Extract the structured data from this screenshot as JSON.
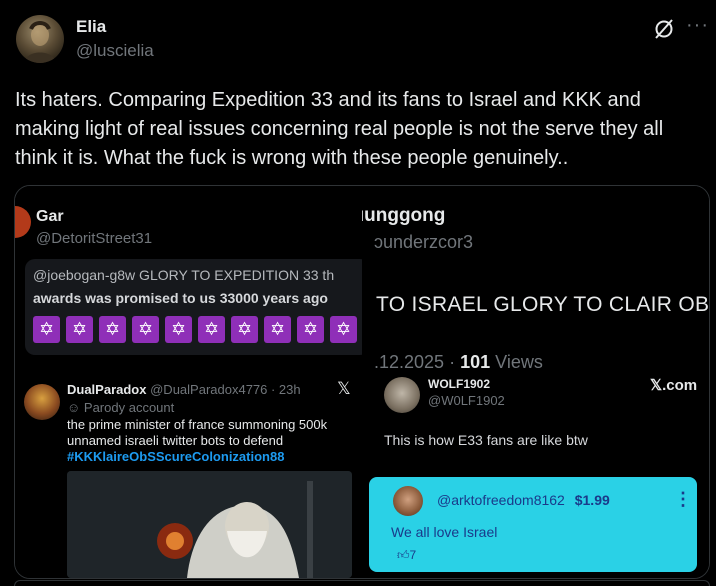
{
  "author": {
    "name": "Elia",
    "handle": "@luscielia"
  },
  "tweet_text": "Its haters. Comparing Expedition 33 and its fans to Israel and KKK and making light of real issues concerning real people is not the serve they all think it is. What the fuck is wrong with these people genuinely..",
  "icons": [
    "grok-icon",
    "more-icon"
  ],
  "more_label": "···",
  "media": {
    "left": {
      "gar_name": "Gar",
      "gar_handle": "@DetoritStreet31",
      "quote_line1": "@joebogan-g8w  GLORY TO EXPEDITION 33 th",
      "quote_line2": "awards was promised to us 33000 years ago",
      "star_glyph": "✡",
      "star_count": 10,
      "post2_name": "DualParadox",
      "post2_meta": "@DualParadox4776 · 23h",
      "post2_x": "𝕏",
      "post2_parody": "Parody account",
      "post2_text1": "the prime minister of france summoning 500k",
      "post2_text2": "unnamed israeli twitter bots to defend",
      "post2_hashtag": "#KKKlaireObSScureColonization88"
    },
    "right": {
      "top_name": "X.cɑunggong",
      "top_handle": "ᴐunderzcor3",
      "headline": "TO ISRAEL GLORY TO CLAIR OBSC",
      "date": ".12.2025",
      "views_count": "101",
      "views_label": "Views",
      "wolf_name": "WOLF1902",
      "wolf_handle": "@W0LF1902",
      "xcom": "𝕏.com",
      "caption": "This is how E33 fans are like btw",
      "inner_handle": "@arktofreedom8162",
      "inner_price": "$1.99",
      "inner_text": "We all love Israel",
      "inner_likes": "7"
    }
  }
}
